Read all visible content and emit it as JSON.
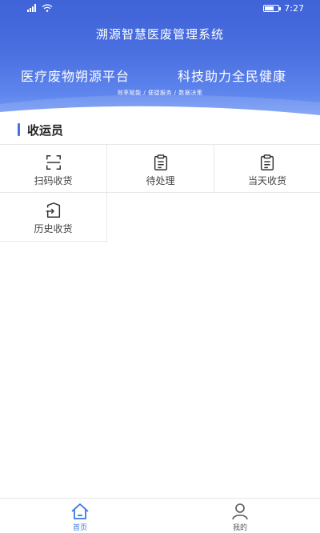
{
  "status_bar": {
    "time": "7:27"
  },
  "header": {
    "title": "溯源智慧医废管理系统",
    "slogan_left": "医疗废物朔源平台",
    "slogan_right": "科技助力全民健康",
    "tagline": "效率赋能 / 便捷服务 / 数据决策"
  },
  "section": {
    "title": "收运员"
  },
  "grid_items": [
    {
      "label": "扫码收货",
      "icon": "scan-icon"
    },
    {
      "label": "待处理",
      "icon": "clipboard-icon"
    },
    {
      "label": "当天收货",
      "icon": "clipboard-icon"
    },
    {
      "label": "历史收货",
      "icon": "history-receive-icon"
    }
  ],
  "tabbar": {
    "home": "首页",
    "mine": "我的"
  },
  "colors": {
    "accent": "#4a6fe0",
    "tab_active": "#3a78e0"
  }
}
